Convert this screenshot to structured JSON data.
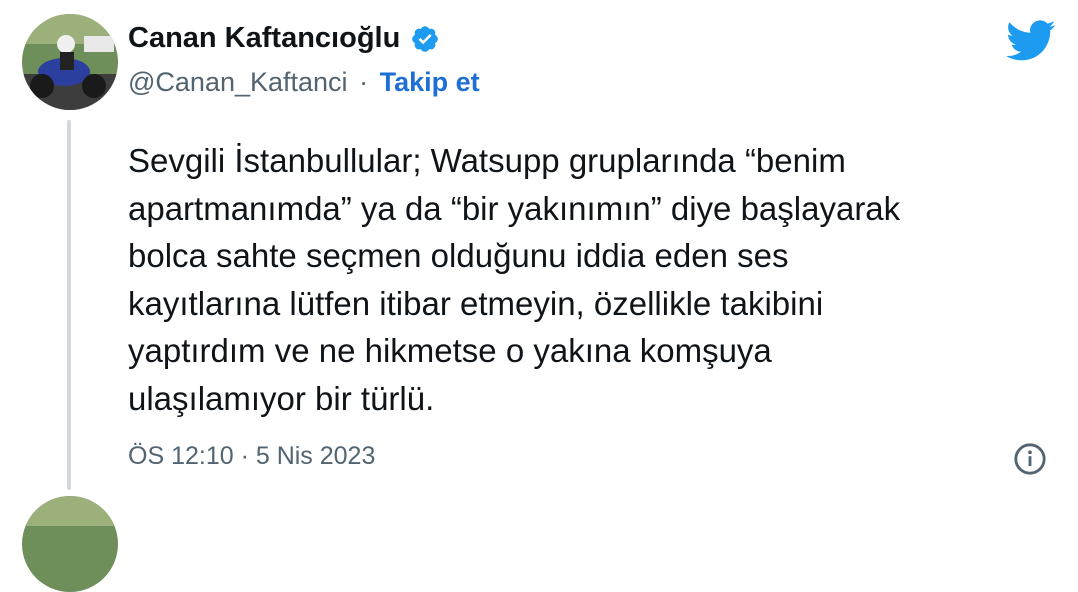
{
  "author": {
    "name": "Canan Kaftancıoğlu",
    "handle": "@Canan_Kaftanci",
    "separator": "·",
    "follow_label": "Takip et"
  },
  "tweet": {
    "text": "Sevgili İstanbullular; Watsupp gruplarında “benim\napartmanımda” ya da “bir yakınımın” diye başlayarak\nbolca sahte seçmen olduğunu iddia eden ses\nkayıtlarına lütfen itibar etmeyin, özellikle takibini\nyaptırdım ve ne hikmetse o yakına komşuya\nulaşılamıyor bir türlü.",
    "timestamp": "ÖS 12:10 · 5 Nis 2023"
  },
  "icons": {
    "verified": "verified-badge-icon",
    "brand": "twitter-bird-icon",
    "info": "info-icon"
  },
  "colors": {
    "brand_blue": "#1d9bf0",
    "link_blue": "#1d6fd6",
    "secondary_text": "#536471",
    "thread_line": "#cfd9de"
  }
}
